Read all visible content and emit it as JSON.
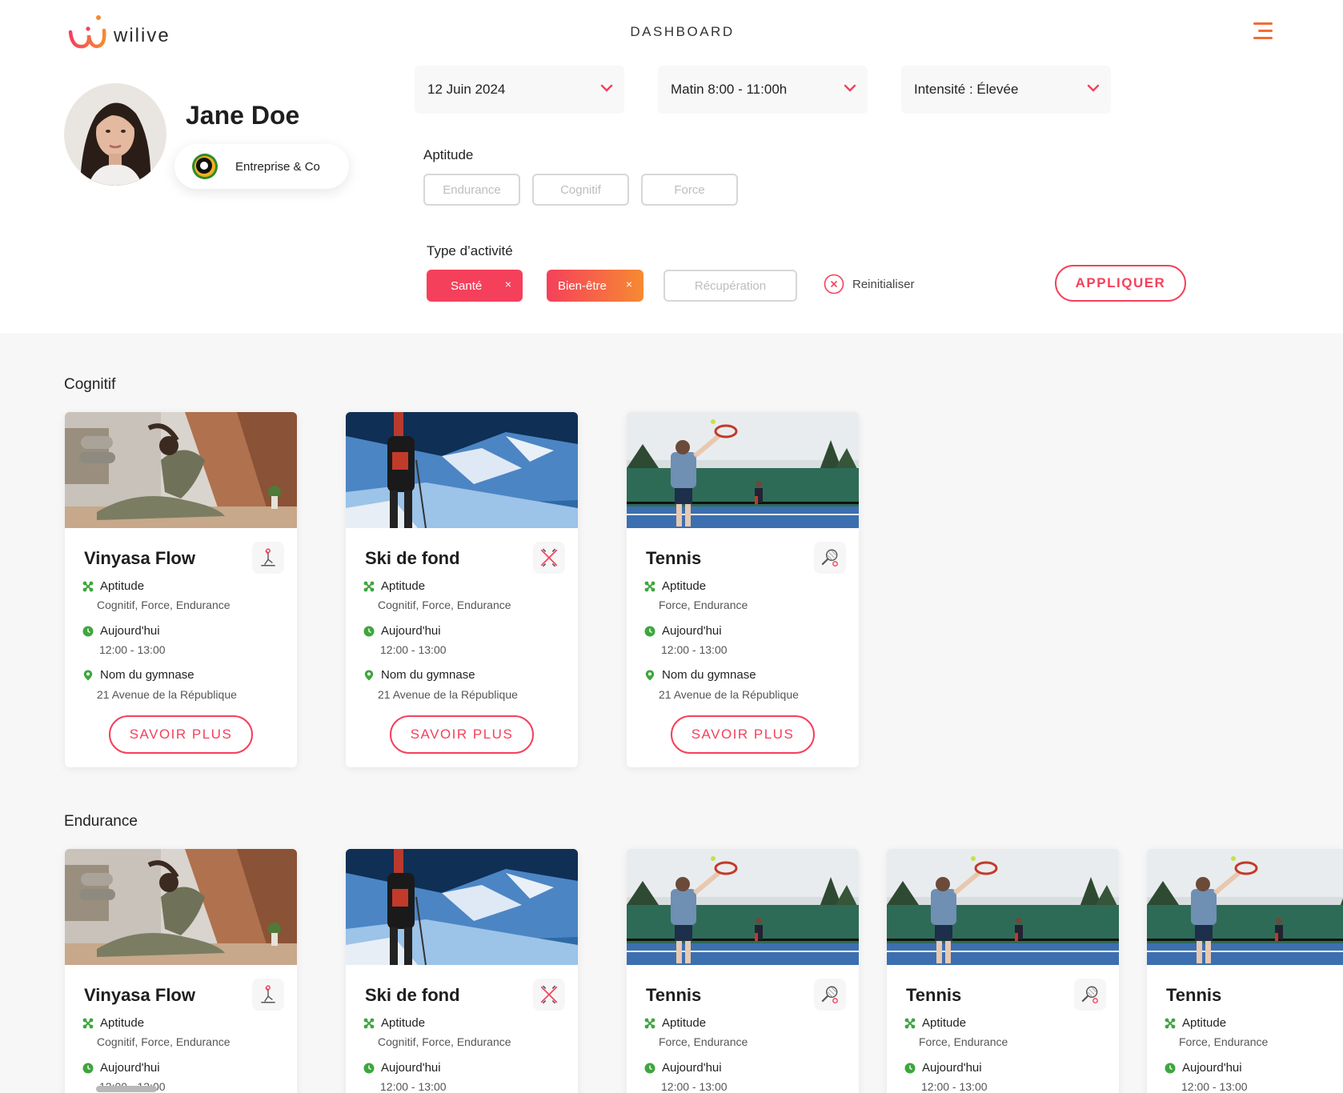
{
  "brand": {
    "name": "wilive",
    "accent": "#f26b3a"
  },
  "header": {
    "title": "DASHBOARD"
  },
  "profile": {
    "name": "Jane Doe",
    "company": "Entreprise & Co"
  },
  "filters": {
    "date": "12 Juin 2024",
    "time": "Matin 8:00 - 11:00h",
    "intensity": "Intensité : Élevée",
    "aptitude_label": "Aptitude",
    "aptitudes": [
      "Endurance",
      "Cognitif",
      "Force"
    ],
    "activity_label": "Type d’activité",
    "activities": [
      {
        "label": "Santé",
        "state": "selected",
        "color": "#f5405b"
      },
      {
        "label": "Bien-être",
        "state": "selected",
        "color": "#f5405b-to-#f68a32"
      },
      {
        "label": "Récupération",
        "state": "unselected"
      }
    ],
    "remove_glyph": "×",
    "reset_label": "Reinitialiser",
    "apply_label": "APPLIQUER"
  },
  "sections": [
    {
      "title": "Cognitif",
      "cards": [
        {
          "image": "yoga",
          "icon": "yoga-icon",
          "title": "Vinyasa Flow",
          "aptitude_label": "Aptitude",
          "aptitudes": "Cognitif, Force, Endurance",
          "day": "Aujourd'hui",
          "hours": "12:00 - 13:00",
          "gym": "Nom du gymnase",
          "address": "21 Avenue de la République",
          "cta": "SAVOIR PLUS"
        },
        {
          "image": "ski",
          "icon": "ski-icon",
          "title": "Ski de fond",
          "aptitude_label": "Aptitude",
          "aptitudes": "Cognitif, Force, Endurance",
          "day": "Aujourd'hui",
          "hours": "12:00 - 13:00",
          "gym": "Nom du gymnase",
          "address": "21 Avenue de la République",
          "cta": "SAVOIR PLUS"
        },
        {
          "image": "tennis",
          "icon": "tennis-racket-icon",
          "title": "Tennis",
          "aptitude_label": "Aptitude",
          "aptitudes": "Force, Endurance",
          "day": "Aujourd'hui",
          "hours": "12:00 - 13:00",
          "gym": "Nom du gymnase",
          "address": "21 Avenue de la République",
          "cta": "SAVOIR PLUS"
        }
      ]
    },
    {
      "title": "Endurance",
      "cards": [
        {
          "image": "yoga",
          "icon": "yoga-icon",
          "title": "Vinyasa Flow",
          "aptitude_label": "Aptitude",
          "aptitudes": "Cognitif, Force, Endurance",
          "day": "Aujourd'hui",
          "hours": "12:00 - 13:00"
        },
        {
          "image": "ski",
          "icon": "ski-icon",
          "title": "Ski de fond",
          "aptitude_label": "Aptitude",
          "aptitudes": "Cognitif, Force, Endurance",
          "day": "Aujourd'hui",
          "hours": "12:00 - 13:00"
        },
        {
          "image": "tennis",
          "icon": "tennis-racket-icon",
          "title": "Tennis",
          "aptitude_label": "Aptitude",
          "aptitudes": "Force, Endurance",
          "day": "Aujourd'hui",
          "hours": "12:00 - 13:00"
        },
        {
          "image": "tennis",
          "icon": "tennis-racket-icon",
          "title": "Tennis",
          "aptitude_label": "Aptitude",
          "aptitudes": "Force, Endurance",
          "day": "Aujourd'hui",
          "hours": "12:00 - 13:00"
        },
        {
          "image": "tennis",
          "icon": "tennis-racket-icon",
          "title": "Tennis",
          "aptitude_label": "Aptitude",
          "aptitudes": "Force, Endurance",
          "day": "Aujourd'hui",
          "hours": "12:00 - 13:00"
        }
      ]
    }
  ]
}
